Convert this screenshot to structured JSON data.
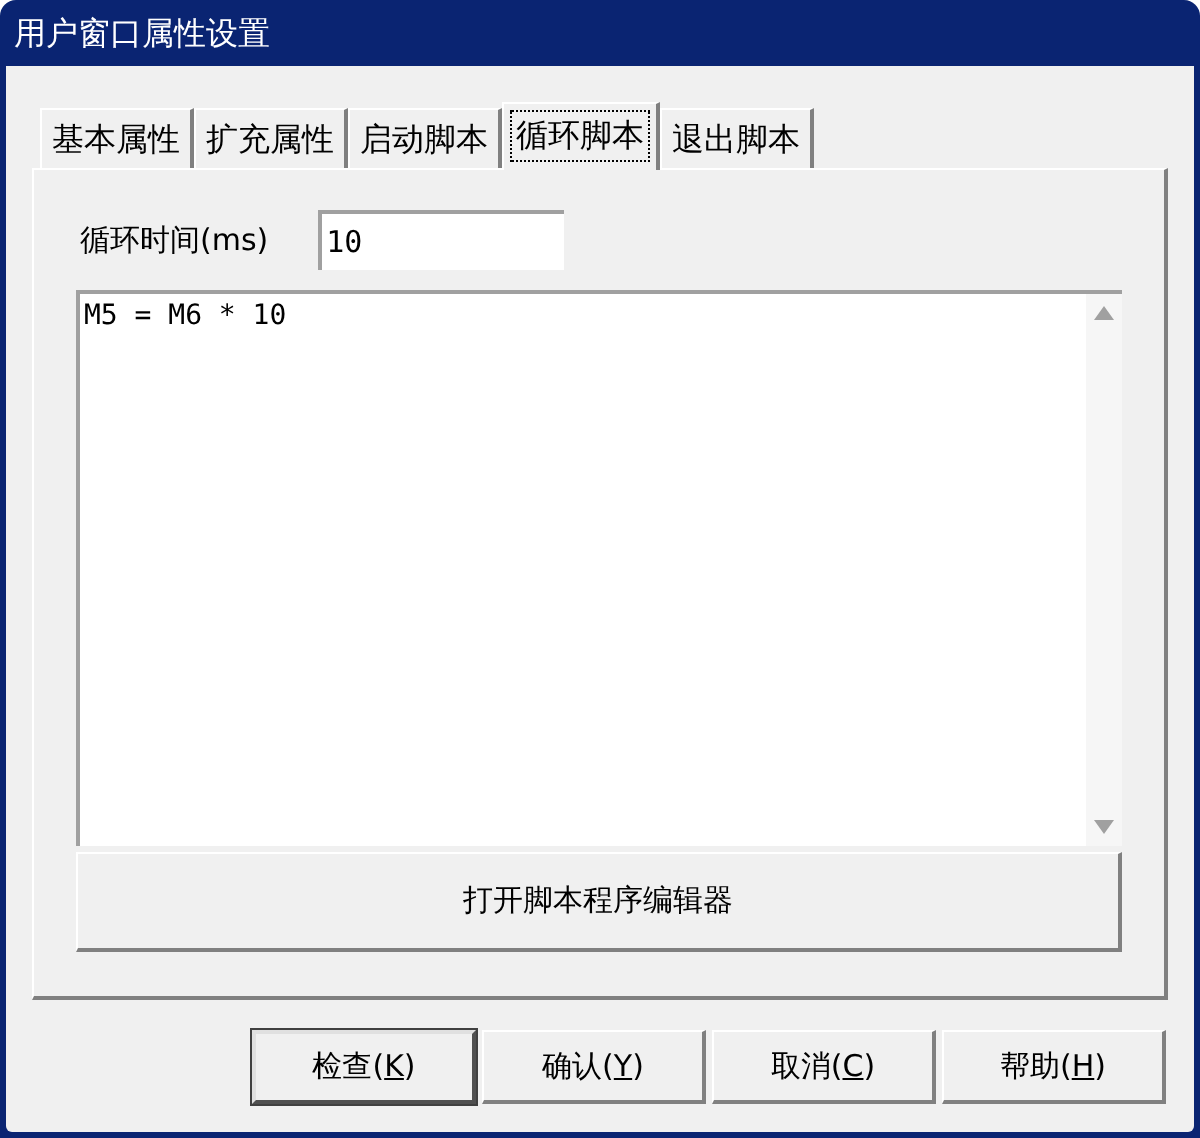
{
  "window": {
    "title": "用户窗口属性设置"
  },
  "tabs": [
    {
      "label": "基本属性",
      "selected": false
    },
    {
      "label": "扩充属性",
      "selected": false
    },
    {
      "label": "启动脚本",
      "selected": false
    },
    {
      "label": "循环脚本",
      "selected": true
    },
    {
      "label": "退出脚本",
      "selected": false
    }
  ],
  "cycle_time": {
    "label": "循环时间(ms)",
    "value": "10"
  },
  "script_editor": {
    "value": "M5 = M6 * 10"
  },
  "open_editor_button": "打开脚本程序编辑器",
  "buttons": [
    {
      "before": "检查(",
      "hotkey": "K",
      "after": ")",
      "default": true
    },
    {
      "before": "确认(",
      "hotkey": "Y",
      "after": ")",
      "default": false
    },
    {
      "before": "取消(",
      "hotkey": "C",
      "after": ")",
      "default": false
    },
    {
      "before": "帮助(",
      "hotkey": "H",
      "after": ")",
      "default": false
    }
  ]
}
